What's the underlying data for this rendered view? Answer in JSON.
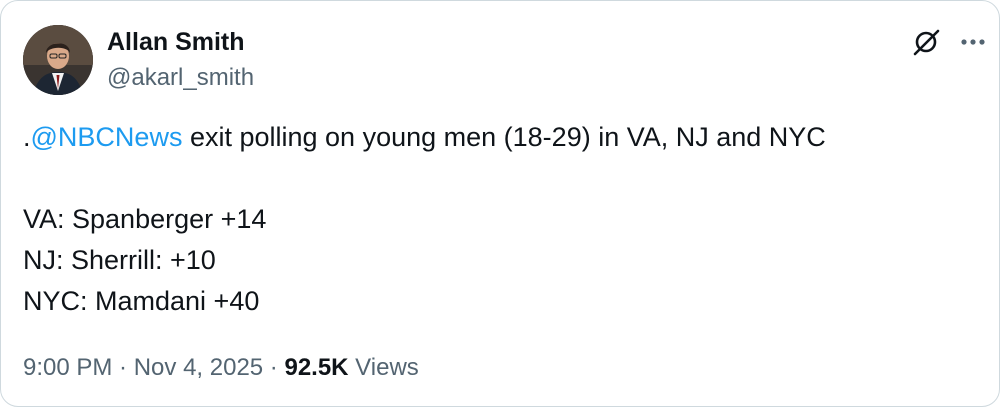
{
  "author": {
    "display_name": "Allan Smith",
    "handle": "@akarl_smith",
    "avatar": "profile-photo"
  },
  "tweet": {
    "prefix": ".",
    "mention": "@NBCNews",
    "line1_rest": " exit polling on young men (18-29) in VA, NJ and NYC",
    "lines": [
      "VA: Spanberger +14",
      "NJ: Sherrill: +10",
      "NYC: Mamdani +40"
    ]
  },
  "meta": {
    "time": "9:00 PM",
    "separator": " · ",
    "date": "Nov 4, 2025",
    "views_count": "92.5K",
    "views_label": " Views"
  },
  "icons": {
    "grok": "grok-icon",
    "more": "more-icon"
  },
  "colors": {
    "text": "#0f1419",
    "secondary": "#536471",
    "link": "#1d9bf0"
  }
}
